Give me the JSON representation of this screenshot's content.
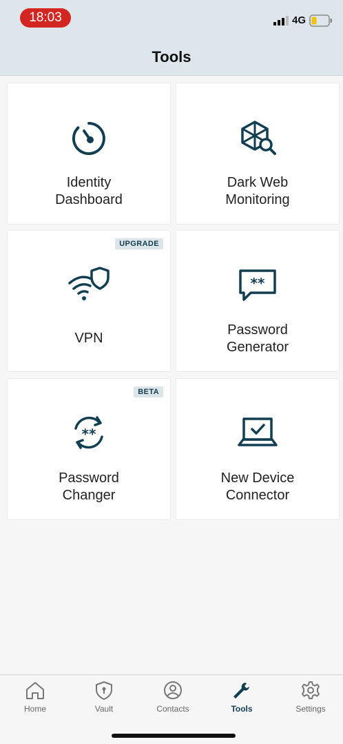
{
  "status_bar": {
    "time": "18:03",
    "network": "4G"
  },
  "header": {
    "title": "Tools"
  },
  "tools": [
    {
      "label": "Identity Dashboard",
      "icon": "gauge-icon",
      "badge": ""
    },
    {
      "label": "Dark Web Monitoring",
      "icon": "network-search-icon",
      "badge": ""
    },
    {
      "label": "VPN",
      "icon": "wifi-shield-icon",
      "badge": "UPGRADE"
    },
    {
      "label": "Password Generator",
      "icon": "password-chat-icon",
      "badge": ""
    },
    {
      "label": "Password Changer",
      "icon": "password-refresh-icon",
      "badge": "BETA"
    },
    {
      "label": "New Device Connector",
      "icon": "laptop-check-icon",
      "badge": ""
    }
  ],
  "tabbar": {
    "items": [
      {
        "label": "Home",
        "icon": "home-icon",
        "active": false
      },
      {
        "label": "Vault",
        "icon": "shield-lock-icon",
        "active": false
      },
      {
        "label": "Contacts",
        "icon": "contact-icon",
        "active": false
      },
      {
        "label": "Tools",
        "icon": "wrench-icon",
        "active": true
      },
      {
        "label": "Settings",
        "icon": "gear-icon",
        "active": false
      }
    ]
  },
  "colors": {
    "accent": "#113e50",
    "header_bg": "#dde6ea",
    "time_pill": "#d32620",
    "battery": "#f2c200"
  }
}
